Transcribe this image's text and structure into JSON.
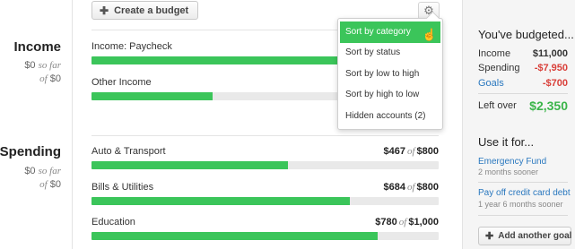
{
  "toolbar": {
    "create_label": "Create a budget",
    "create_icon": "plus-icon",
    "settings_icon": "gear-icon"
  },
  "sort_menu": {
    "items": [
      {
        "label": "Sort by category",
        "active": true
      },
      {
        "label": "Sort by status",
        "active": false
      },
      {
        "label": "Sort by low to high",
        "active": false
      },
      {
        "label": "Sort by high to low",
        "active": false
      },
      {
        "label": "Hidden accounts (2)",
        "active": false
      }
    ],
    "cursor_icon": "hand-pointer-icon"
  },
  "income": {
    "title": "Income",
    "summary_amount": "$0",
    "summary_sofar": "so far",
    "summary_of": "of",
    "summary_total": "$0",
    "rows": [
      {
        "label": "Income: Paycheck",
        "progress": 1.0
      },
      {
        "label": "Other Income",
        "progress": 0.35
      }
    ]
  },
  "spending": {
    "title": "Spending",
    "summary_amount": "$0",
    "summary_sofar": "so far",
    "summary_of": "of",
    "summary_total": "$0",
    "rows": [
      {
        "label": "Auto & Transport",
        "spent": "$467",
        "of": "of",
        "budget": "$800",
        "progress": 0.566
      },
      {
        "label": "Bills & Utilities",
        "spent": "$684",
        "of": "of",
        "budget": "$800",
        "progress": 0.744
      },
      {
        "label": "Education",
        "spent": "$780",
        "of": "of",
        "budget": "$1,000",
        "progress": 0.825
      }
    ]
  },
  "summary": {
    "title": "You've budgeted...",
    "income_label": "Income",
    "income_value": "$11,000",
    "spending_label": "Spending",
    "spending_value": "-$7,950",
    "goals_label": "Goals",
    "goals_value": "-$700",
    "leftover_label": "Left over",
    "leftover_value": "$2,350"
  },
  "use_it": {
    "title": "Use it for...",
    "goals": [
      {
        "name": "Emergency Fund",
        "sub": "2 months sooner"
      },
      {
        "name": "Pay off credit card debt",
        "sub": "1 year 6 months sooner"
      }
    ],
    "add_goal_label": "Add another goal"
  },
  "colors": {
    "progress": "#3bc55a",
    "negative": "#d9403a",
    "positive": "#3bb54a",
    "link": "#2a78bf"
  }
}
